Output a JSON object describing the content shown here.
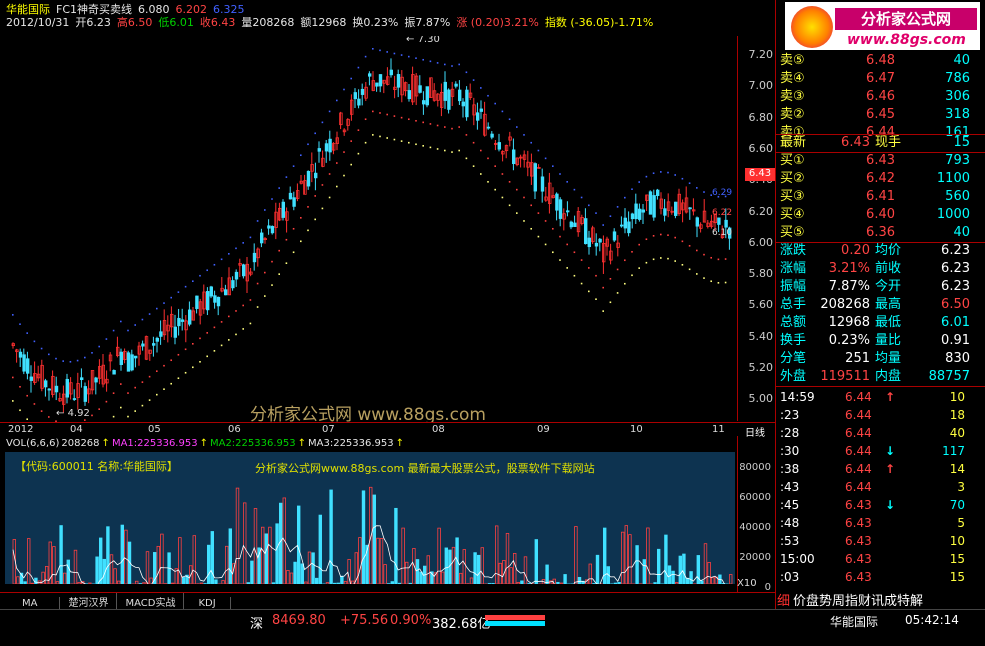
{
  "header": {
    "name": "华能国际",
    "indicator": "FC1神奇买卖线",
    "v1": "6.080",
    "v2": "6.202",
    "v3": "6.325",
    "date": "2012/10/31",
    "open_label": "开6.23",
    "high_label": "高6.50",
    "low_label": "低6.01",
    "close_label": "收6.43",
    "vol_label": "量208268",
    "amount_label": "额12968",
    "turnover_label": "换0.23%",
    "amp_label": "振7.87%",
    "change_label": "涨 (0.20)3.21%",
    "index_label": "指数 (-36.05)-1.71%"
  },
  "annotations": {
    "high": "7.30",
    "low": "4.92",
    "mark1": "6.29",
    "mark2": "6.22",
    "mark3": "6.10",
    "watermark": "分析家公式网 www.88gs.com"
  },
  "price_axis": [
    "7.20",
    "7.00",
    "6.80",
    "6.60",
    "6.40",
    "6.20",
    "6.00",
    "5.80",
    "5.60",
    "5.40",
    "5.20",
    "5.00"
  ],
  "current_price_tag": "6.43",
  "dates": [
    "2012",
    "04",
    "05",
    "06",
    "07",
    "08",
    "09",
    "10",
    "11"
  ],
  "period_label": "日线",
  "vol": {
    "label": "VOL(6,6,6)",
    "value": "208268",
    "ma1": "MA1:225336.953",
    "ma2": "MA2:225336.953",
    "ma3": "MA3:225336.953",
    "info": "【代码:600011 名称:华能国际】",
    "ad": "分析家公式网www.88gs.com 最新最大股票公式，股票软件下载网站",
    "axis": [
      "80000",
      "60000",
      "40000",
      "20000",
      "0"
    ],
    "unit": "X10"
  },
  "tabs": [
    "MA",
    "楚河汉界",
    "MACD实战",
    "KDJ"
  ],
  "status": {
    "market": "深",
    "index": "8469.80",
    "change": "+75.56",
    "pct": "0.90%",
    "amount": "382.68亿",
    "bottom_name": "华能国际",
    "time": "05:42:14"
  },
  "logo": {
    "title": "分析家公式网",
    "url": "www.88gs.com"
  },
  "orderbook": {
    "asks": [
      {
        "label": "卖⑤",
        "price": "6.48",
        "vol": "40"
      },
      {
        "label": "卖④",
        "price": "6.47",
        "vol": "786"
      },
      {
        "label": "卖③",
        "price": "6.46",
        "vol": "306"
      },
      {
        "label": "卖②",
        "price": "6.45",
        "vol": "318"
      },
      {
        "label": "卖①",
        "price": "6.44",
        "vol": "161"
      }
    ],
    "last": {
      "label": "最新",
      "price": "6.43",
      "lbl2": "现手",
      "vol": "15"
    },
    "bids": [
      {
        "label": "买①",
        "price": "6.43",
        "vol": "793"
      },
      {
        "label": "买②",
        "price": "6.42",
        "vol": "1100"
      },
      {
        "label": "买③",
        "price": "6.41",
        "vol": "560"
      },
      {
        "label": "买④",
        "price": "6.40",
        "vol": "1000"
      },
      {
        "label": "买⑤",
        "price": "6.36",
        "vol": "40"
      }
    ]
  },
  "stats": [
    {
      "l1": "涨跌",
      "v1": "0.20",
      "l2": "均价",
      "v2": "6.23"
    },
    {
      "l1": "涨幅",
      "v1": "3.21%",
      "l2": "前收",
      "v2": "6.23"
    },
    {
      "l1": "振幅",
      "v1": "7.87%",
      "l2": "今开",
      "v2": "6.23"
    },
    {
      "l1": "总手",
      "v1": "208268",
      "l2": "最高",
      "v2": "6.50"
    },
    {
      "l1": "总额",
      "v1": "12968",
      "l2": "最低",
      "v2": "6.01"
    },
    {
      "l1": "换手",
      "v1": "0.23%",
      "l2": "量比",
      "v2": "0.91"
    },
    {
      "l1": "分笔",
      "v1": "251",
      "l2": "均量",
      "v2": "830"
    }
  ],
  "waipan": {
    "l1": "外盘",
    "v1": "119511",
    "l2": "内盘",
    "v2": "88757"
  },
  "ticks": [
    {
      "t": "14:59",
      "p": "6.44",
      "ar": "↑",
      "v": "10"
    },
    {
      "t": ":23",
      "p": "6.44",
      "ar": "",
      "v": "18"
    },
    {
      "t": ":28",
      "p": "6.44",
      "ar": "",
      "v": "40"
    },
    {
      "t": ":30",
      "p": "6.44",
      "ar": "↓",
      "v": "117"
    },
    {
      "t": ":38",
      "p": "6.44",
      "ar": "↑",
      "v": "14"
    },
    {
      "t": ":43",
      "p": "6.44",
      "ar": "",
      "v": "3"
    },
    {
      "t": ":45",
      "p": "6.43",
      "ar": "↓",
      "v": "70"
    },
    {
      "t": ":48",
      "p": "6.43",
      "ar": "",
      "v": "5"
    },
    {
      "t": ":53",
      "p": "6.43",
      "ar": "",
      "v": "10"
    },
    {
      "t": "15:00",
      "p": "6.43",
      "ar": "",
      "v": "15"
    },
    {
      "t": ":03",
      "p": "6.43",
      "ar": "",
      "v": "15"
    }
  ],
  "bottom_tabs": "细价盘势周指财讯成特解"
}
